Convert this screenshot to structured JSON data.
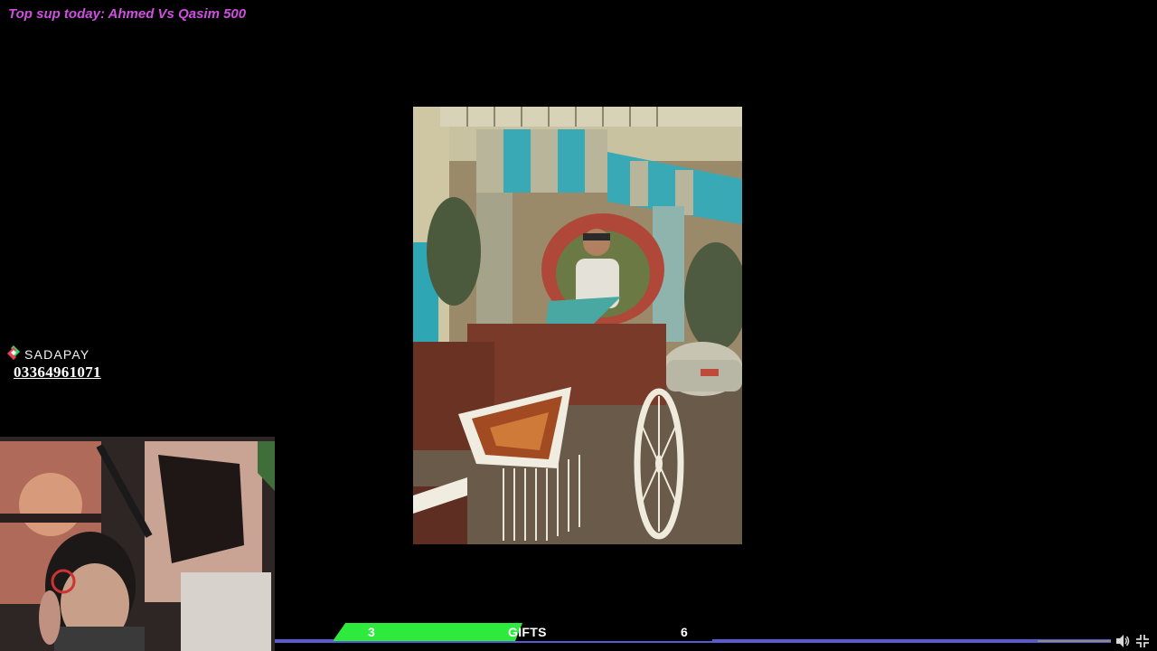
{
  "banner": {
    "text": "Top sup today: Ahmed Vs Qasim 500",
    "color": "#cf4fe0"
  },
  "sadapay": {
    "brand": "SADAPAY",
    "number": "03364961071",
    "icon": "sadapay-logo-icon"
  },
  "gifts": {
    "current": "3",
    "label": "GIFTS",
    "goal": "6",
    "progress_fraction": 0.5,
    "fill_color": "#2eea3c"
  },
  "player": {
    "progress_fraction": 0.91,
    "track_color": "#5a5ad0",
    "volume_icon": "volume-icon",
    "fullscreen_icon": "exit-fullscreen-icon"
  }
}
